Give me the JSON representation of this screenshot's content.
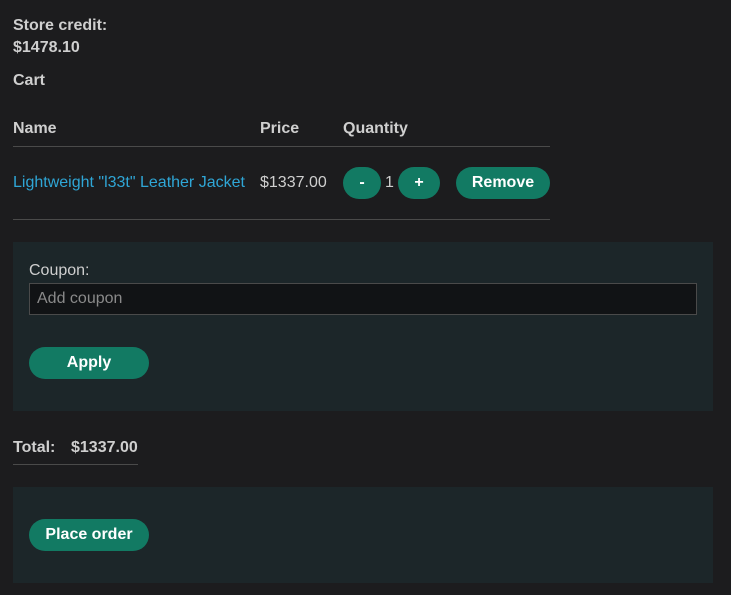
{
  "store_credit": {
    "label": "Store credit:",
    "value": "$1478.10"
  },
  "cart": {
    "title": "Cart",
    "columns": {
      "name": "Name",
      "price": "Price",
      "quantity": "Quantity"
    },
    "items": [
      {
        "name": "Lightweight \"l33t\" Leather Jacket",
        "price": "$1337.00",
        "quantity": "1",
        "decrement_label": "-",
        "increment_label": "+",
        "remove_label": "Remove"
      }
    ]
  },
  "coupon": {
    "label": "Coupon:",
    "placeholder": "Add coupon",
    "value": "",
    "apply_label": "Apply"
  },
  "total": {
    "label": "Total:",
    "value": "$1337.00"
  },
  "order": {
    "place_label": "Place order"
  },
  "colors": {
    "background": "#1c1c1e",
    "panel": "#1c2629",
    "accent": "#127a63",
    "link": "#2fa6d6"
  }
}
